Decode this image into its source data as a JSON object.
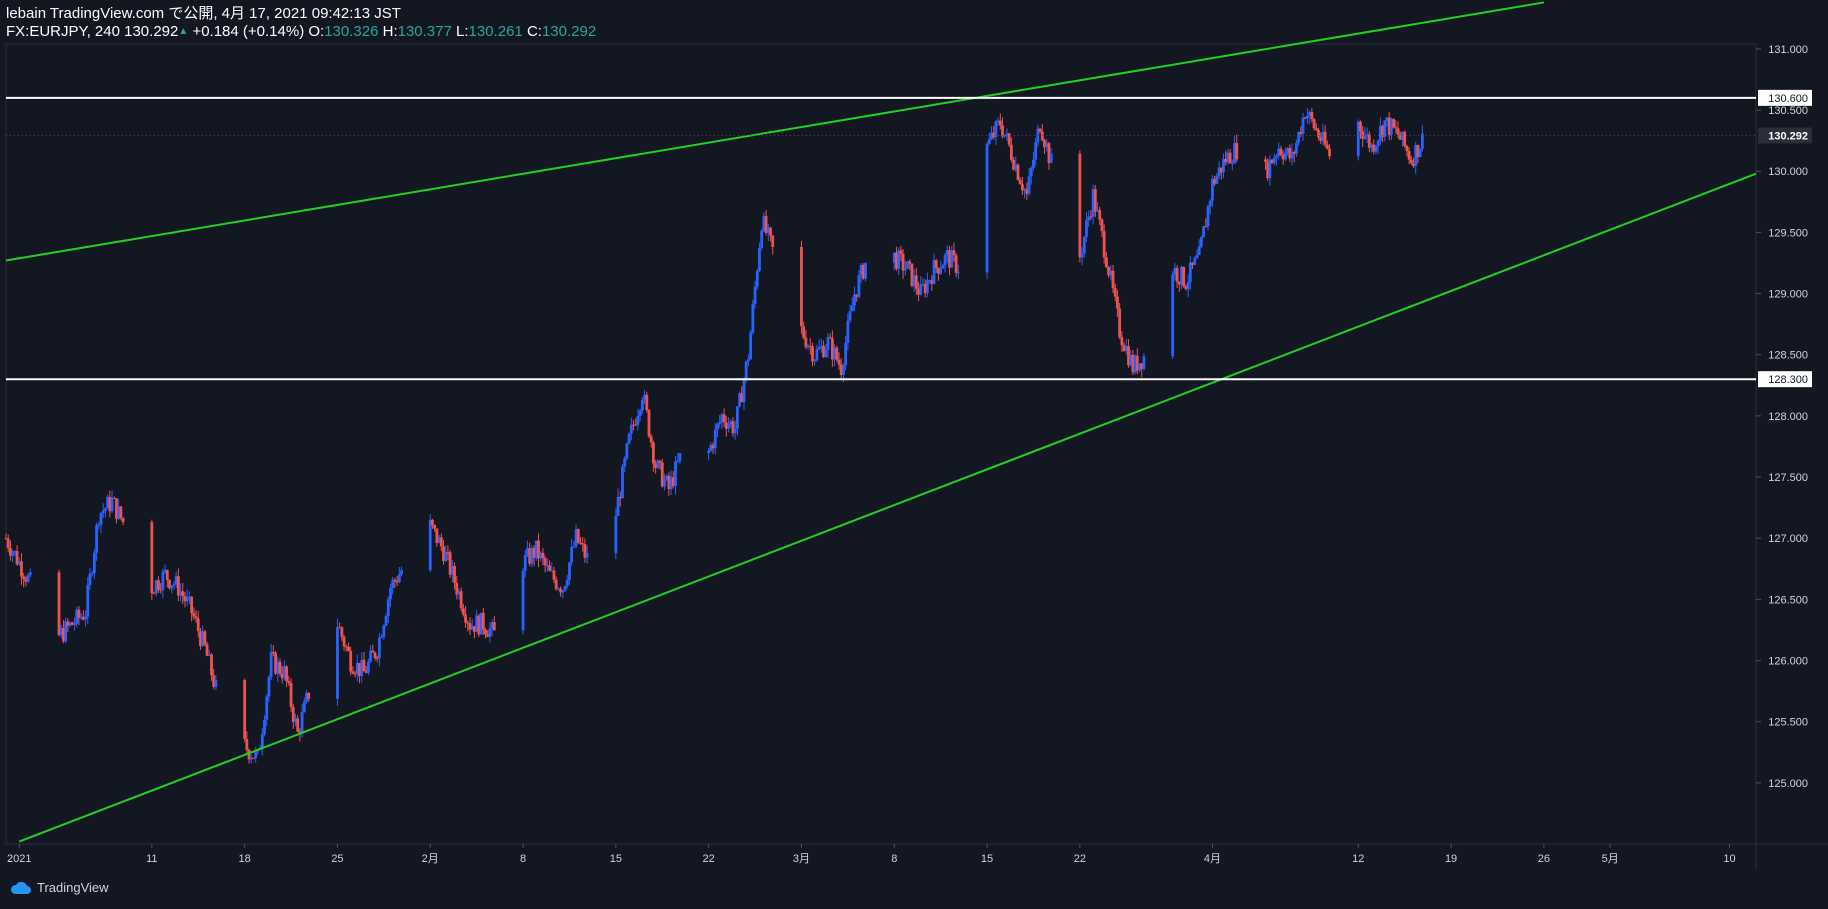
{
  "header": {
    "line1": "lebain TradingView.com で公開, 4月 17, 2021 09:42:13 JST",
    "symbol": "FX:EURJPY, 240",
    "last": "130.292",
    "change": "+0.184 (+0.14%)",
    "o_label": "O:",
    "o": "130.326",
    "h_label": "H:",
    "h": "130.377",
    "l_label": "L:",
    "l": "130.261",
    "c_label": "C:",
    "c": "130.292"
  },
  "footer": {
    "brand": "TradingView"
  },
  "colors": {
    "background": "#131722",
    "up": "#2962ff",
    "down": "#ef5350",
    "trendline": "#22d022",
    "hline": "#ffffff",
    "axis_text": "#d1d4dc",
    "teal": "#26a69a"
  },
  "chart_data": {
    "type": "candlestick",
    "interval": "240",
    "ylim": [
      124.5,
      131.4
    ],
    "y_ticks": [
      125.0,
      125.5,
      126.0,
      126.5,
      127.0,
      127.5,
      128.0,
      128.5,
      129.0,
      129.5,
      130.0,
      130.5,
      131.0
    ],
    "y_tick_labels": [
      "125.000",
      "125.500",
      "126.000",
      "126.500",
      "127.000",
      "127.500",
      "128.000",
      "128.500",
      "129.000",
      "129.500",
      "130.000",
      "130.500",
      "131.000"
    ],
    "x_range": [
      "2020-12-31",
      "2021-05-12"
    ],
    "x_ticks": [
      {
        "date": "2021-01-01",
        "label": "2021"
      },
      {
        "date": "2021-01-11",
        "label": "11"
      },
      {
        "date": "2021-01-18",
        "label": "18"
      },
      {
        "date": "2021-01-25",
        "label": "25"
      },
      {
        "date": "2021-02-01",
        "label": "2月"
      },
      {
        "date": "2021-02-08",
        "label": "8"
      },
      {
        "date": "2021-02-15",
        "label": "15"
      },
      {
        "date": "2021-02-22",
        "label": "22"
      },
      {
        "date": "2021-03-01",
        "label": "3月"
      },
      {
        "date": "2021-03-08",
        "label": "8"
      },
      {
        "date": "2021-03-15",
        "label": "15"
      },
      {
        "date": "2021-03-22",
        "label": "22"
      },
      {
        "date": "2021-04-01",
        "label": "4月"
      },
      {
        "date": "2021-04-12",
        "label": "12"
      },
      {
        "date": "2021-04-19",
        "label": "19"
      },
      {
        "date": "2021-04-26",
        "label": "26"
      },
      {
        "date": "2021-05-01",
        "label": "5月"
      },
      {
        "date": "2021-05-10",
        "label": "10"
      }
    ],
    "close_path": [
      [
        "2020-12-31",
        127.0
      ],
      [
        "2021-01-04",
        126.2
      ],
      [
        "2021-01-05",
        126.3
      ],
      [
        "2021-01-06",
        126.4
      ],
      [
        "2021-01-07",
        127.2
      ],
      [
        "2021-01-08",
        127.3
      ],
      [
        "2021-01-10",
        126.9
      ],
      [
        "2021-01-11",
        126.6
      ],
      [
        "2021-01-12",
        126.7
      ],
      [
        "2021-01-13",
        126.6
      ],
      [
        "2021-01-14",
        126.4
      ],
      [
        "2021-01-15",
        126.1
      ],
      [
        "2021-01-16",
        125.7
      ],
      [
        "2021-01-18",
        125.3
      ],
      [
        "2021-01-19",
        125.2
      ],
      [
        "2021-01-20",
        126.0
      ],
      [
        "2021-01-21",
        125.9
      ],
      [
        "2021-01-22",
        125.4
      ],
      [
        "2021-01-23",
        125.8
      ],
      [
        "2021-01-25",
        126.3
      ],
      [
        "2021-01-26",
        126.0
      ],
      [
        "2021-01-27",
        125.9
      ],
      [
        "2021-01-28",
        126.1
      ],
      [
        "2021-01-29",
        126.6
      ],
      [
        "2021-02-01",
        127.1
      ],
      [
        "2021-02-02",
        126.9
      ],
      [
        "2021-02-03",
        126.6
      ],
      [
        "2021-02-04",
        126.3
      ],
      [
        "2021-02-05",
        126.3
      ],
      [
        "2021-02-06",
        126.2
      ],
      [
        "2021-02-08",
        126.8
      ],
      [
        "2021-02-09",
        126.9
      ],
      [
        "2021-02-10",
        126.7
      ],
      [
        "2021-02-11",
        126.6
      ],
      [
        "2021-02-12",
        127.0
      ],
      [
        "2021-02-13",
        126.8
      ],
      [
        "2021-02-14",
        127.1
      ],
      [
        "2021-02-15",
        127.2
      ],
      [
        "2021-02-16",
        127.8
      ],
      [
        "2021-02-17",
        128.2
      ],
      [
        "2021-02-18",
        127.6
      ],
      [
        "2021-02-19",
        127.4
      ],
      [
        "2021-02-20",
        127.7
      ],
      [
        "2021-02-21",
        127.8
      ],
      [
        "2021-02-22",
        127.7
      ],
      [
        "2021-02-23",
        128.0
      ],
      [
        "2021-02-24",
        127.9
      ],
      [
        "2021-02-25",
        128.5
      ],
      [
        "2021-02-26",
        129.6
      ],
      [
        "2021-02-27",
        129.3
      ],
      [
        "2021-03-01",
        128.7
      ],
      [
        "2021-03-02",
        128.5
      ],
      [
        "2021-03-03",
        128.6
      ],
      [
        "2021-03-04",
        128.4
      ],
      [
        "2021-03-05",
        129.0
      ],
      [
        "2021-03-06",
        129.3
      ],
      [
        "2021-03-07",
        129.1
      ],
      [
        "2021-03-08",
        129.3
      ],
      [
        "2021-03-09",
        129.2
      ],
      [
        "2021-03-10",
        129.0
      ],
      [
        "2021-03-11",
        129.2
      ],
      [
        "2021-03-12",
        129.3
      ],
      [
        "2021-03-13",
        129.2
      ],
      [
        "2021-03-14",
        129.7
      ],
      [
        "2021-03-15",
        130.2
      ],
      [
        "2021-03-16",
        130.4
      ],
      [
        "2021-03-17",
        130.1
      ],
      [
        "2021-03-18",
        129.8
      ],
      [
        "2021-03-19",
        130.4
      ],
      [
        "2021-03-20",
        130.0
      ],
      [
        "2021-03-21",
        129.5
      ],
      [
        "2021-03-22",
        129.3
      ],
      [
        "2021-03-23",
        129.8
      ],
      [
        "2021-03-24",
        129.3
      ],
      [
        "2021-03-25",
        128.7
      ],
      [
        "2021-03-26",
        128.4
      ],
      [
        "2021-03-27",
        128.5
      ],
      [
        "2021-03-28",
        128.7
      ],
      [
        "2021-03-29",
        129.2
      ],
      [
        "2021-03-30",
        129.1
      ],
      [
        "2021-03-31",
        129.3
      ],
      [
        "2021-04-01",
        129.9
      ],
      [
        "2021-04-02",
        130.1
      ],
      [
        "2021-04-03",
        130.2
      ],
      [
        "2021-04-05",
        130.0
      ],
      [
        "2021-04-06",
        130.2
      ],
      [
        "2021-04-07",
        130.1
      ],
      [
        "2021-04-08",
        130.5
      ],
      [
        "2021-04-09",
        130.3
      ],
      [
        "2021-04-10",
        130.1
      ],
      [
        "2021-04-11",
        130.2
      ],
      [
        "2021-04-12",
        130.4
      ],
      [
        "2021-04-13",
        130.2
      ],
      [
        "2021-04-14",
        130.4
      ],
      [
        "2021-04-15",
        130.3
      ],
      [
        "2021-04-16",
        130.1
      ],
      [
        "2021-04-17",
        130.29
      ]
    ],
    "horizontal_lines": [
      {
        "price": 130.6,
        "label": "130.600"
      },
      {
        "price": 128.3,
        "label": "128.300"
      }
    ],
    "trendlines": [
      {
        "from": [
          "2020-12-31",
          129.27
        ],
        "to": [
          "2021-04-26",
          131.38
        ]
      },
      {
        "from": [
          "2021-01-01",
          124.52
        ],
        "to": [
          "2021-05-12",
          129.98
        ]
      }
    ],
    "last_price": {
      "price": 130.292,
      "label": "130.292"
    }
  }
}
